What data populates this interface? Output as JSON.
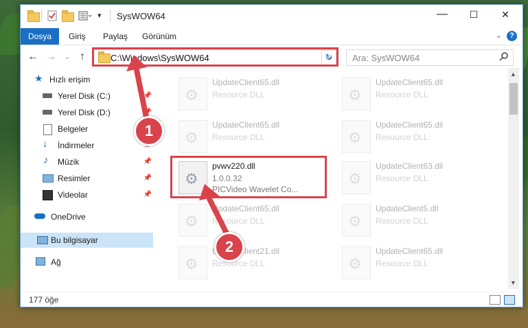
{
  "window": {
    "title": "SysWOW64",
    "minimize": "—",
    "maximize": "☐",
    "close": "✕"
  },
  "ribbon": {
    "tabs": [
      "Dosya",
      "Giriş",
      "Paylaş",
      "Görünüm"
    ],
    "help": "?",
    "collapse": "⌄"
  },
  "nav": {
    "back": "←",
    "forward": "→",
    "recent": "⌄",
    "up": "↑",
    "address": "C:\\Windows\\SysWOW64",
    "address_dropdown": "⌄",
    "refresh": "↻",
    "search_placeholder": "Ara: SysWOW64",
    "search_icon": "🔍"
  },
  "sidebar": {
    "items": [
      {
        "label": "Hızlı erişim",
        "icon": "star-icon"
      },
      {
        "label": "Yerel Disk (C:)",
        "icon": "drive-icon",
        "pinned": true
      },
      {
        "label": "Yerel Disk (D:)",
        "icon": "drive-icon",
        "pinned": true
      },
      {
        "label": "Belgeler",
        "icon": "documents-icon",
        "pinned": true
      },
      {
        "label": "İndirmeler",
        "icon": "downloads-icon",
        "pinned": true
      },
      {
        "label": "Müzik",
        "icon": "music-icon",
        "pinned": true
      },
      {
        "label": "Resimler",
        "icon": "pictures-icon",
        "pinned": true
      },
      {
        "label": "Videolar",
        "icon": "videos-icon",
        "pinned": true
      },
      {
        "label": "OneDrive",
        "icon": "cloud-icon"
      },
      {
        "label": "Bu bilgisayar",
        "icon": "computer-icon",
        "selected": true
      },
      {
        "label": "Ağ",
        "icon": "network-icon"
      }
    ],
    "pin_glyph": "📌"
  },
  "files": [
    {
      "name": "UpdateClient65.dll",
      "type": "Resource DLL"
    },
    {
      "name": "UpdateClient65.dll",
      "type": "Resource DLL"
    },
    {
      "name": "UpdateClient65.dll",
      "type": "Resource DLL"
    },
    {
      "name": "UpdateClient65.dll",
      "type": "Resource DLL"
    },
    {
      "name": "pvwv220.dll",
      "version": "1.0.0.32",
      "desc": "PICVideo Wavelet Co..."
    },
    {
      "name": "UpdateClient63.dll",
      "type": "Resource DLL"
    },
    {
      "name": "UpdateClient65.dll",
      "type": "Resource DLL"
    },
    {
      "name": "UpdateClient5.dll",
      "type": "Resource DLL"
    },
    {
      "name": "UpdateClient21.dll",
      "type": "Resource DLL"
    },
    {
      "name": "UpdateClient65.dll",
      "type": "Resource DLL"
    }
  ],
  "status": {
    "count": "177 öğe"
  },
  "annotations": {
    "step1": "1",
    "step2": "2"
  },
  "colors": {
    "accent": "#1a6fc4",
    "highlight": "#d9434b",
    "selected_bg": "#cce4f7"
  }
}
